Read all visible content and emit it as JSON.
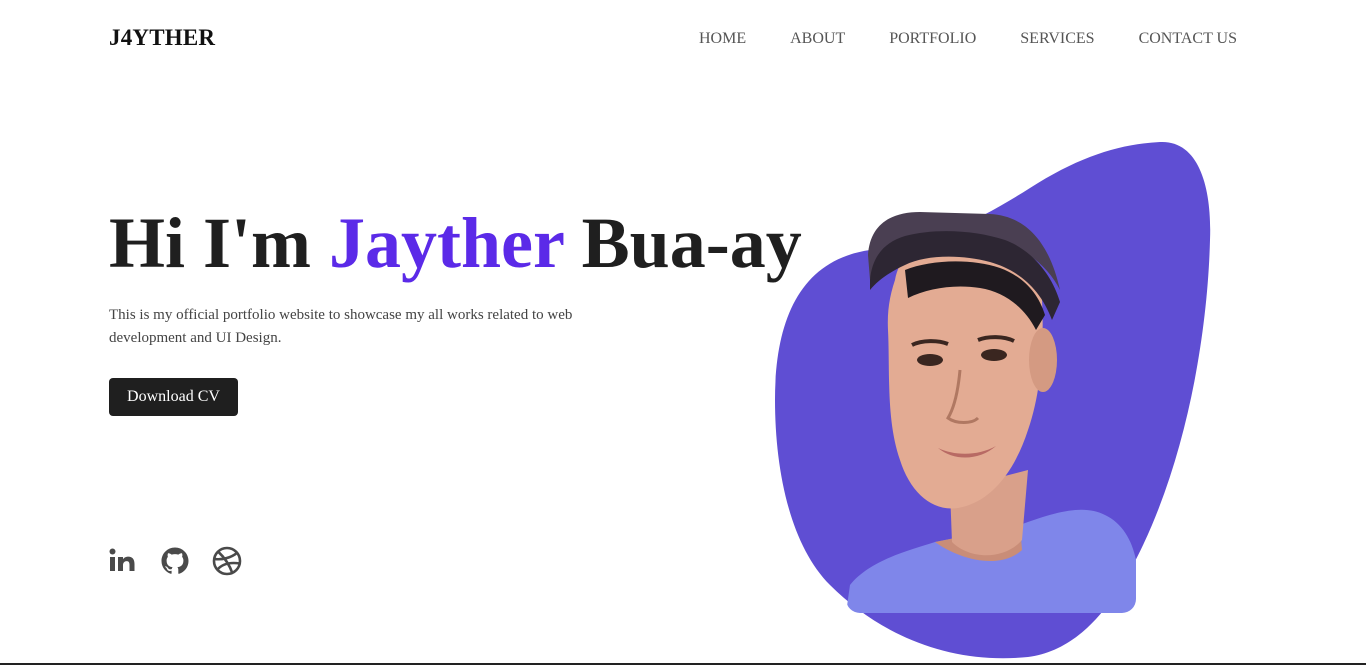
{
  "header": {
    "logo": "J4YTHER",
    "nav": [
      {
        "label": "HOME"
      },
      {
        "label": "ABOUT"
      },
      {
        "label": "PORTFOLIO"
      },
      {
        "label": "SERVICES"
      },
      {
        "label": "CONTACT US"
      }
    ]
  },
  "hero": {
    "title_prefix": "Hi I'm ",
    "title_highlight": "Jayther",
    "title_suffix": " Bua-ay",
    "description": "This is my official portfolio website to showcase my all works related to web development and UI Design.",
    "cta_label": "Download CV"
  },
  "socials": [
    {
      "icon": "linkedin-icon"
    },
    {
      "icon": "github-icon"
    },
    {
      "icon": "dribbble-icon"
    }
  ],
  "colors": {
    "accent": "#5b2ae8",
    "blob": "#5f4ed3",
    "dark": "#1f1f1f",
    "text_muted": "#444444"
  }
}
